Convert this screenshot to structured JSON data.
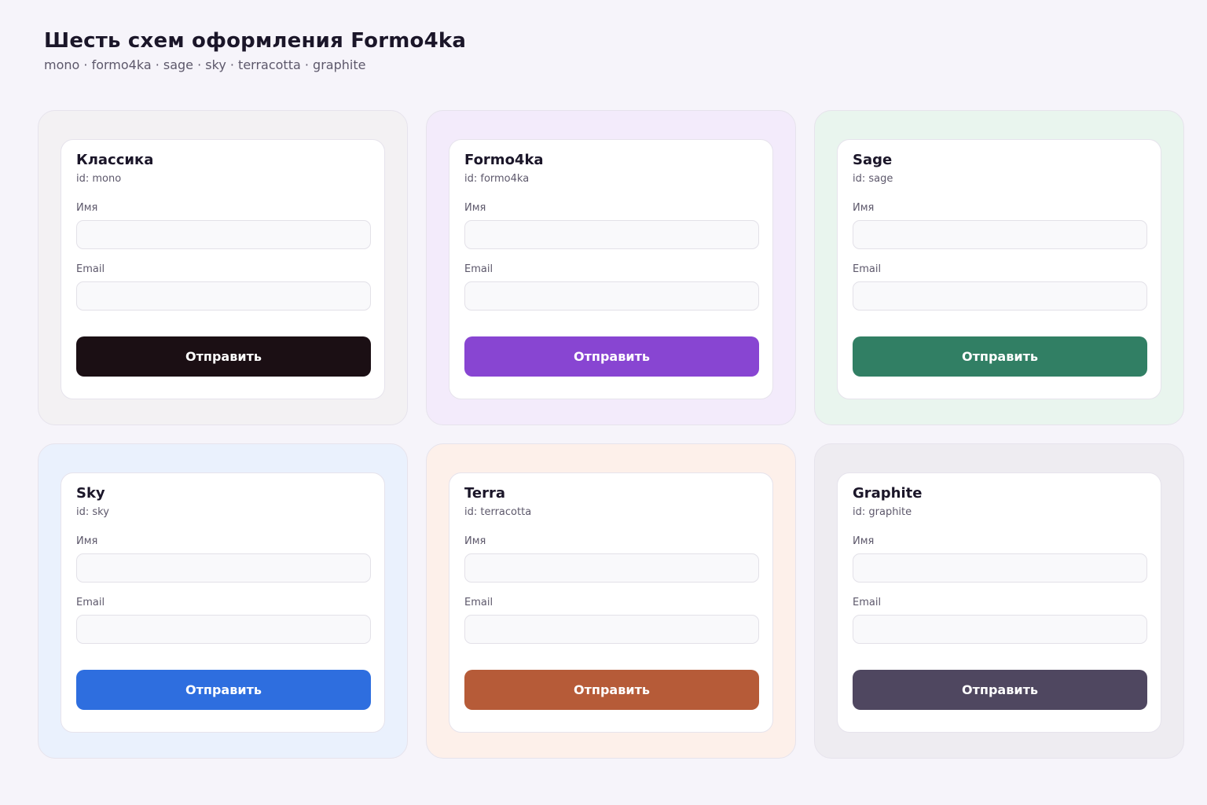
{
  "header": {
    "title": "Шесть схем оформления Formo4ka",
    "subtitle": "mono · formo4ka · sage · sky · terracotta · graphite"
  },
  "schemes": [
    {
      "title": "Классика",
      "id_label": "id: mono",
      "name_label": "Имя",
      "email_label": "Email",
      "button_label": "Отправить",
      "panel_color": "#f3f1f3",
      "button_color": "#1b0f14"
    },
    {
      "title": "Formo4ka",
      "id_label": "id: formo4ka",
      "name_label": "Имя",
      "email_label": "Email",
      "button_label": "Отправить",
      "panel_color": "#f3ebfb",
      "button_color": "#8845d2"
    },
    {
      "title": "Sage",
      "id_label": "id: sage",
      "name_label": "Имя",
      "email_label": "Email",
      "button_label": "Отправить",
      "panel_color": "#e9f5ee",
      "button_color": "#317f64"
    },
    {
      "title": "Sky",
      "id_label": "id: sky",
      "name_label": "Имя",
      "email_label": "Email",
      "button_label": "Отправить",
      "panel_color": "#eaf1fd",
      "button_color": "#2e6edf"
    },
    {
      "title": "Terra",
      "id_label": "id: terracotta",
      "name_label": "Имя",
      "email_label": "Email",
      "button_label": "Отправить",
      "panel_color": "#fdf0ea",
      "button_color": "#b65b38"
    },
    {
      "title": "Graphite",
      "id_label": "id: graphite",
      "name_label": "Имя",
      "email_label": "Email",
      "button_label": "Отправить",
      "panel_color": "#eeecf1",
      "button_color": "#4f4760"
    }
  ]
}
